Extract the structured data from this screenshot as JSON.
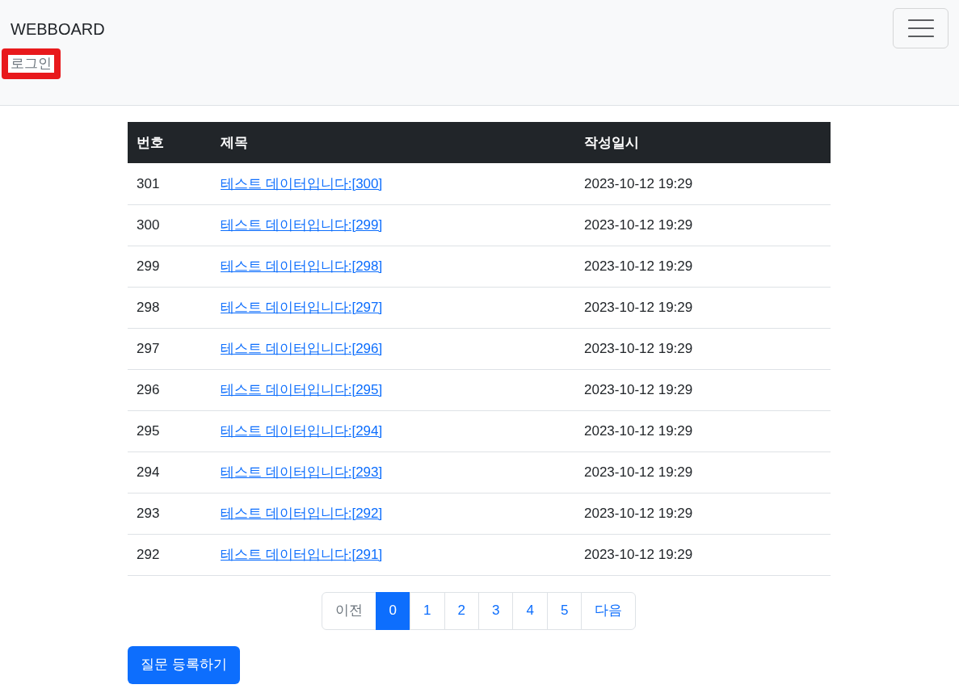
{
  "navbar": {
    "brand": "WEBBOARD",
    "login_link": {
      "label": "로그인",
      "highlighted": true
    }
  },
  "table": {
    "columns": [
      "번호",
      "제목",
      "작성일시"
    ],
    "rows": [
      {
        "number": "301",
        "title": "테스트 데이터입니다:[300]",
        "date": "2023-10-12 19:29"
      },
      {
        "number": "300",
        "title": "테스트 데이터입니다:[299]",
        "date": "2023-10-12 19:29"
      },
      {
        "number": "299",
        "title": "테스트 데이터입니다:[298]",
        "date": "2023-10-12 19:29"
      },
      {
        "number": "298",
        "title": "테스트 데이터입니다:[297]",
        "date": "2023-10-12 19:29"
      },
      {
        "number": "297",
        "title": "테스트 데이터입니다:[296]",
        "date": "2023-10-12 19:29"
      },
      {
        "number": "296",
        "title": "테스트 데이터입니다:[295]",
        "date": "2023-10-12 19:29"
      },
      {
        "number": "295",
        "title": "테스트 데이터입니다:[294]",
        "date": "2023-10-12 19:29"
      },
      {
        "number": "294",
        "title": "테스트 데이터입니다:[293]",
        "date": "2023-10-12 19:29"
      },
      {
        "number": "293",
        "title": "테스트 데이터입니다:[292]",
        "date": "2023-10-12 19:29"
      },
      {
        "number": "292",
        "title": "테스트 데이터입니다:[291]",
        "date": "2023-10-12 19:29"
      }
    ]
  },
  "pagination": [
    {
      "label": "이전",
      "selected": false,
      "disabled": true
    },
    {
      "label": "0",
      "selected": true,
      "disabled": false
    },
    {
      "label": "1",
      "selected": false,
      "disabled": false
    },
    {
      "label": "2",
      "selected": false,
      "disabled": false
    },
    {
      "label": "3",
      "selected": false,
      "disabled": false
    },
    {
      "label": "4",
      "selected": false,
      "disabled": false
    },
    {
      "label": "5",
      "selected": false,
      "disabled": false
    },
    {
      "label": "다음",
      "selected": false,
      "disabled": false
    }
  ],
  "create_button": "질문 등록하기"
}
